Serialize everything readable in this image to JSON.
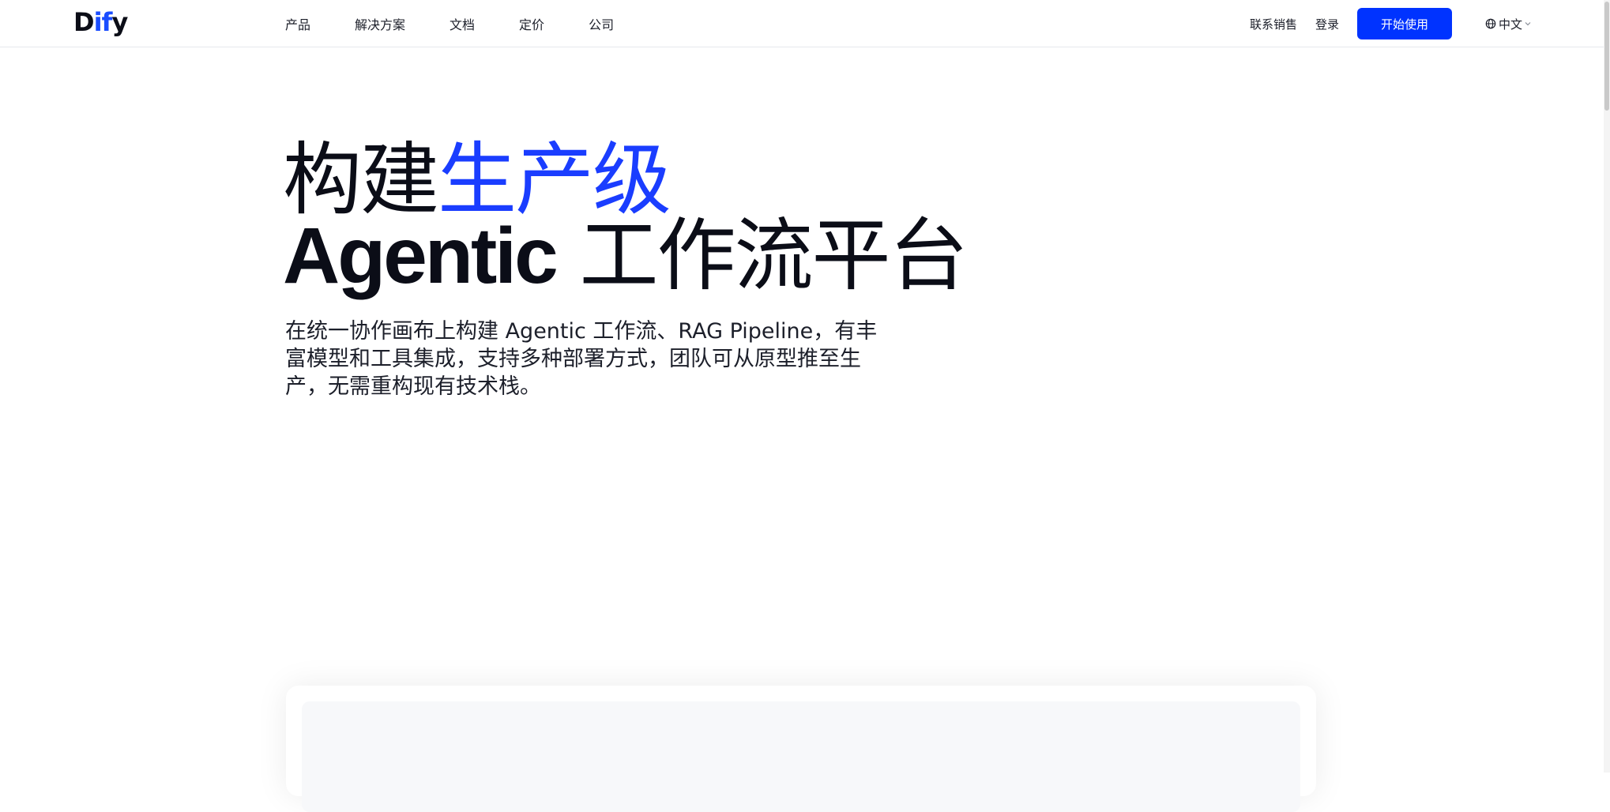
{
  "header": {
    "logo": {
      "prefix": "D",
      "accent": "if",
      "suffix": "y"
    },
    "nav": [
      {
        "label": "产品"
      },
      {
        "label": "解决方案"
      },
      {
        "label": "文档"
      },
      {
        "label": "定价"
      },
      {
        "label": "公司"
      }
    ],
    "contact_sales": "联系销售",
    "login": "登录",
    "cta": "开始使用",
    "language": "中文"
  },
  "hero": {
    "title_line1_prefix": "构建",
    "title_line1_accent": "生产级",
    "title_line2_latin": "Agentic",
    "title_line2_rest": " 工作流平台",
    "description": "在统一协作画布上构建 Agentic 工作流、RAG Pipeline，有丰富模型和工具集成，支持多种部署方式，团队可从原型推至生产，无需重构现有技术栈。"
  },
  "colors": {
    "accent": "#1a3dff",
    "cta_background": "#0033ff",
    "text": "#0b0d17"
  },
  "icons": {
    "language": "globe-icon",
    "dropdown": "chevron-down-icon"
  }
}
